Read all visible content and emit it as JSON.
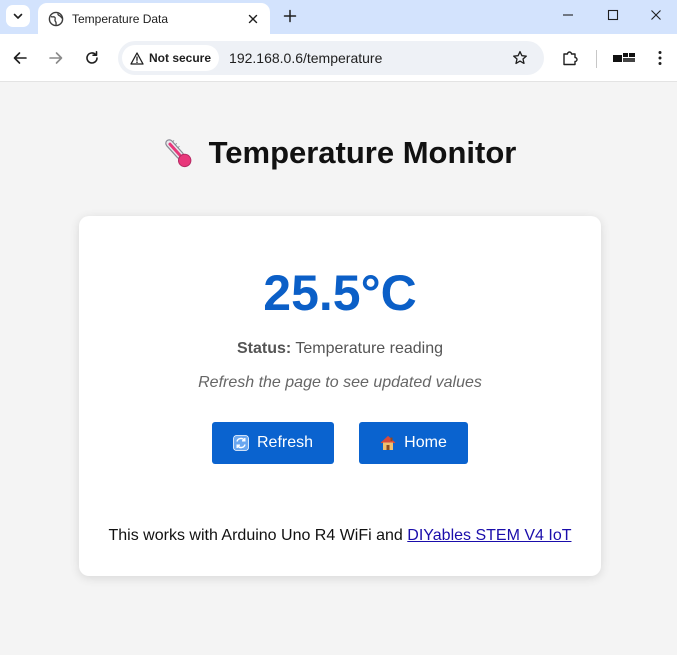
{
  "browser": {
    "tab_title": "Temperature Data",
    "security_label": "Not secure",
    "url": "192.168.0.6/temperature"
  },
  "page": {
    "heading": "Temperature Monitor",
    "temperature": "25.5°C",
    "status_label": "Status:",
    "status_value": "Temperature reading",
    "hint": "Refresh the page to see updated values",
    "refresh_label": "Refresh",
    "home_label": "Home",
    "footer_text": "This works with Arduino Uno R4 WiFi and ",
    "footer_link": "DIYables STEM V4 IoT"
  },
  "colors": {
    "accent": "#0a63cf",
    "temperature": "#0b5fc7",
    "tabstrip": "#d3e3fd"
  },
  "icons": {
    "heading": "thermometer-icon",
    "refresh": "refresh-icon",
    "home": "house-icon"
  }
}
